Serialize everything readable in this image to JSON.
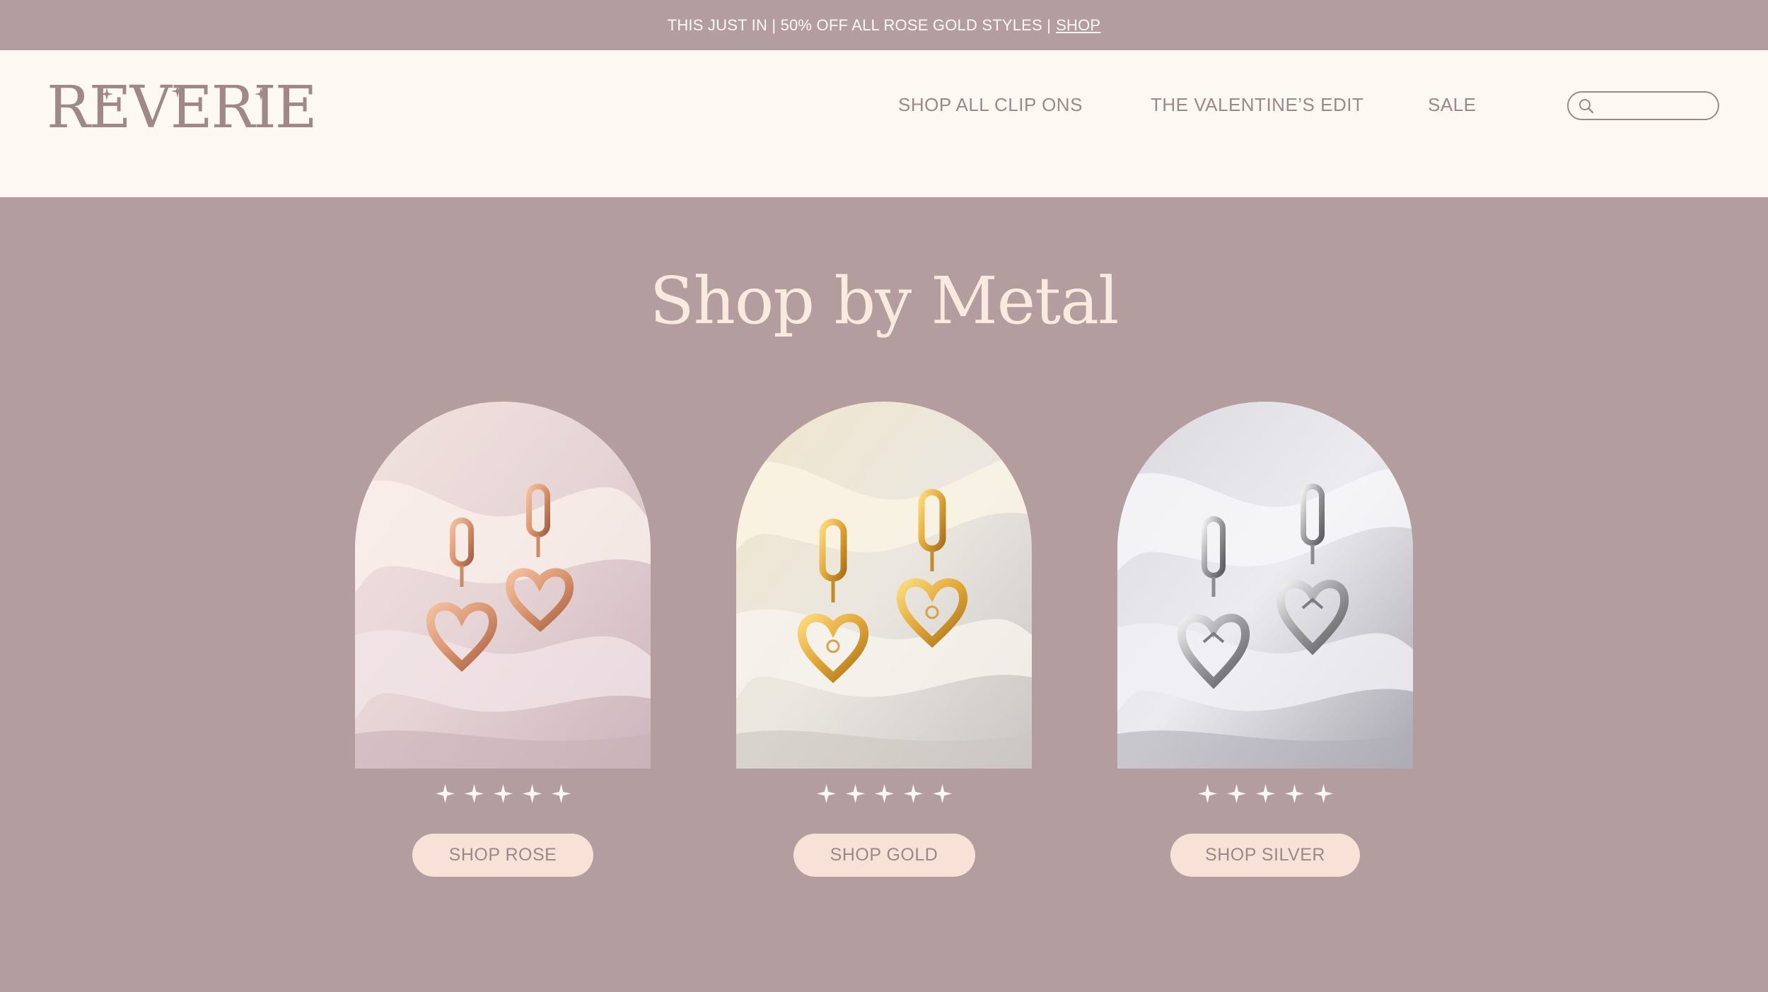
{
  "announcement": {
    "text": "THIS JUST IN | 50% OFF ALL ROSE GOLD STYLES |",
    "link": "SHOP"
  },
  "header": {
    "logo": "REVERIE",
    "nav": [
      "SHOP ALL CLIP ONS",
      "THE VALENTINE’S EDIT",
      "SALE"
    ],
    "search": {
      "placeholder": "",
      "value": ""
    }
  },
  "main": {
    "heading": "Shop by Metal",
    "products": [
      {
        "metal": "rose",
        "button": "SHOP ROSE",
        "rating": 5
      },
      {
        "metal": "gold",
        "button": "SHOP GOLD",
        "rating": 5
      },
      {
        "metal": "silver",
        "button": "SHOP SILVER",
        "rating": 5
      }
    ]
  },
  "colors": {
    "background": "#b49d9e",
    "header": "#fdf8f2",
    "accent_text": "#9d8888",
    "heading": "#f9e9df",
    "button": "#f8e1d7",
    "rose_metal": "#d9946e",
    "gold_metal": "#e1a636",
    "silver_metal": "#9a9a9c"
  },
  "icons": {
    "search": "search-icon",
    "star": "sparkle-star-icon"
  }
}
